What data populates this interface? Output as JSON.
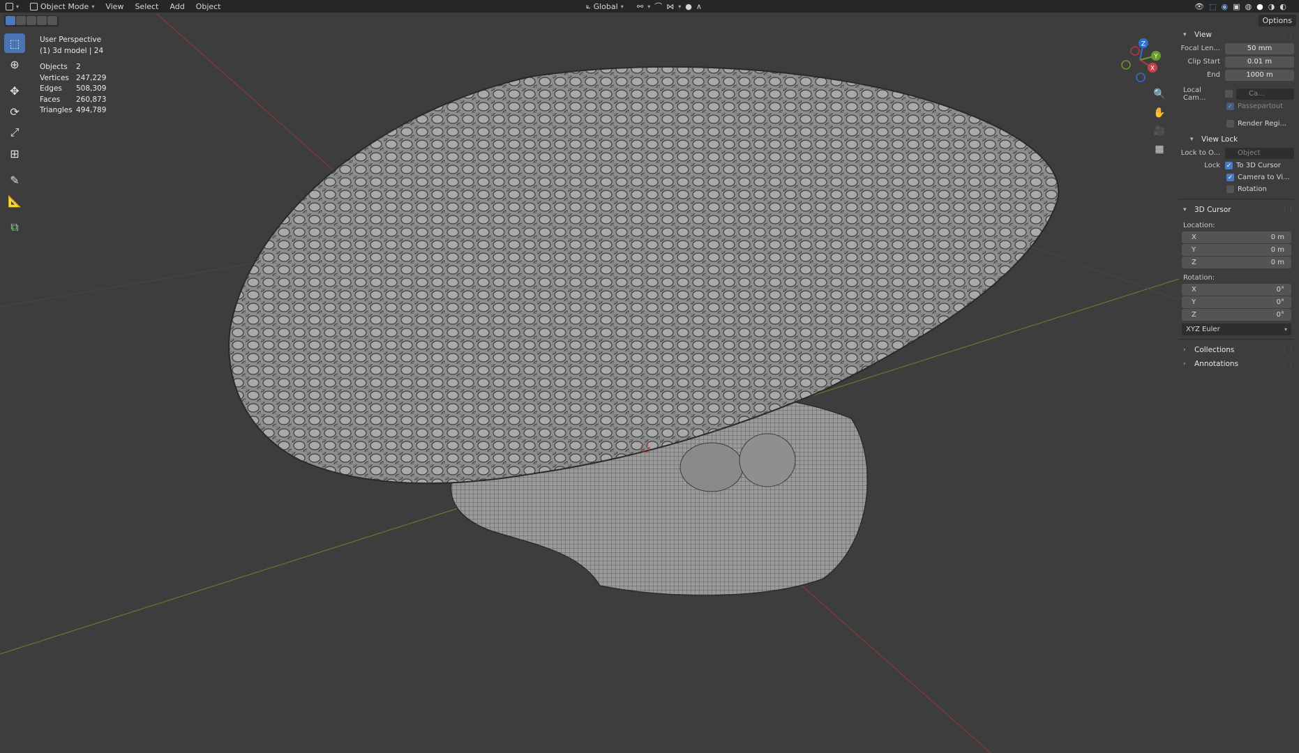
{
  "header": {
    "mode": "Object Mode",
    "menus": [
      "View",
      "Select",
      "Add",
      "Object"
    ],
    "transform_orientation": "Global",
    "options_label": "Options"
  },
  "overlay": {
    "view_name": "User Perspective",
    "object_info": "(1) 3d model | 24",
    "stats": [
      {
        "label": "Objects",
        "value": "2"
      },
      {
        "label": "Vertices",
        "value": "247,229"
      },
      {
        "label": "Edges",
        "value": "508,309"
      },
      {
        "label": "Faces",
        "value": "260,873"
      },
      {
        "label": "Triangles",
        "value": "494,789"
      }
    ]
  },
  "gizmo": {
    "x": "X",
    "y": "Y",
    "z": "Z"
  },
  "sidebar": {
    "view": {
      "title": "View",
      "focal_label": "Focal Len...",
      "focal_value": "50 mm",
      "clip_start_label": "Clip Start",
      "clip_start_value": "0.01 m",
      "end_label": "End",
      "end_value": "1000 m",
      "local_cam_label": "Local Cam...",
      "local_cam_value": "Ca...",
      "passepartout": "Passepartout",
      "render_region": "Render Regi..."
    },
    "view_lock": {
      "title": "View Lock",
      "lock_to_label": "Lock to O...",
      "lock_to_value": "Object",
      "lock_label": "Lock",
      "to_cursor": "To 3D Cursor",
      "camera_to_view": "Camera to Vi...",
      "rotation": "Rotation"
    },
    "cursor": {
      "title": "3D Cursor",
      "location_label": "Location:",
      "loc_x": "0 m",
      "loc_y": "0 m",
      "loc_z": "0 m",
      "rotation_label": "Rotation:",
      "rot_x": "0°",
      "rot_y": "0°",
      "rot_z": "0°",
      "mode": "XYZ Euler",
      "axis_x": "X",
      "axis_y": "Y",
      "axis_z": "Z"
    },
    "collections": "Collections",
    "annotations": "Annotations"
  },
  "colors": {
    "viewport_bg": "#3d3d3d",
    "header_bg": "#262626",
    "accent": "#4a7bc0",
    "x_axis": "#b8383d",
    "y_axis": "#6b9a2e",
    "z_axis": "#2f6fd0"
  }
}
